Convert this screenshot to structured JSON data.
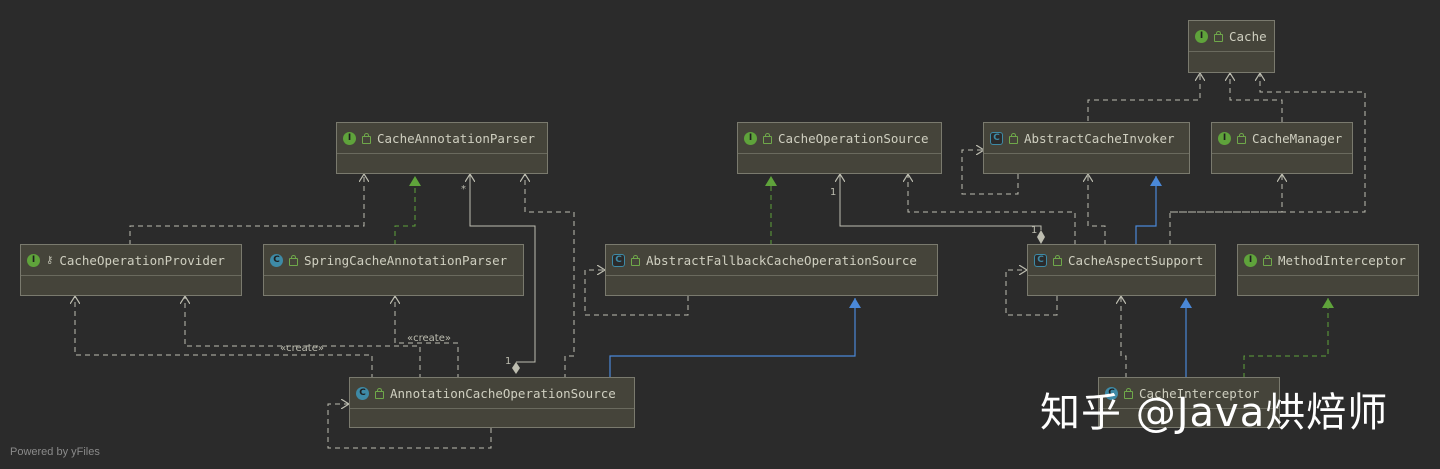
{
  "diagram": {
    "nodes": [
      {
        "id": "cache",
        "name": "Cache",
        "kind": "interface"
      },
      {
        "id": "cache-annotation-parser",
        "name": "CacheAnnotationParser",
        "kind": "interface"
      },
      {
        "id": "cache-operation-source",
        "name": "CacheOperationSource",
        "kind": "interface"
      },
      {
        "id": "abstract-cache-invoker",
        "name": "AbstractCacheInvoker",
        "kind": "abstract-class"
      },
      {
        "id": "cache-manager",
        "name": "CacheManager",
        "kind": "interface"
      },
      {
        "id": "cache-operation-provider",
        "name": "CacheOperationProvider",
        "kind": "interface"
      },
      {
        "id": "spring-cache-annotation-parser",
        "name": "SpringCacheAnnotationParser",
        "kind": "class"
      },
      {
        "id": "abstract-fallback-cache-operation-source",
        "name": "AbstractFallbackCacheOperationSource",
        "kind": "abstract-class"
      },
      {
        "id": "cache-aspect-support",
        "name": "CacheAspectSupport",
        "kind": "abstract-class"
      },
      {
        "id": "method-interceptor",
        "name": "MethodInterceptor",
        "kind": "interface"
      },
      {
        "id": "annotation-cache-operation-source",
        "name": "AnnotationCacheOperationSource",
        "kind": "class"
      },
      {
        "id": "cache-interceptor",
        "name": "CacheInterceptor",
        "kind": "class"
      }
    ],
    "edge_labels": {
      "create1": "«create»",
      "create2": "«create»",
      "mult_star": "*",
      "mult_one_a": "1",
      "mult_one_b": "1",
      "mult_one_c": "1"
    },
    "colors": {
      "background": "#2b2b2b",
      "node_fill": "#45443a",
      "dependency": "#bdbdb0",
      "implements": "#5fa33b",
      "extends": "#4a88d8"
    }
  },
  "footer": "Powered by yFiles",
  "watermark": "知乎 @Java烘焙师"
}
